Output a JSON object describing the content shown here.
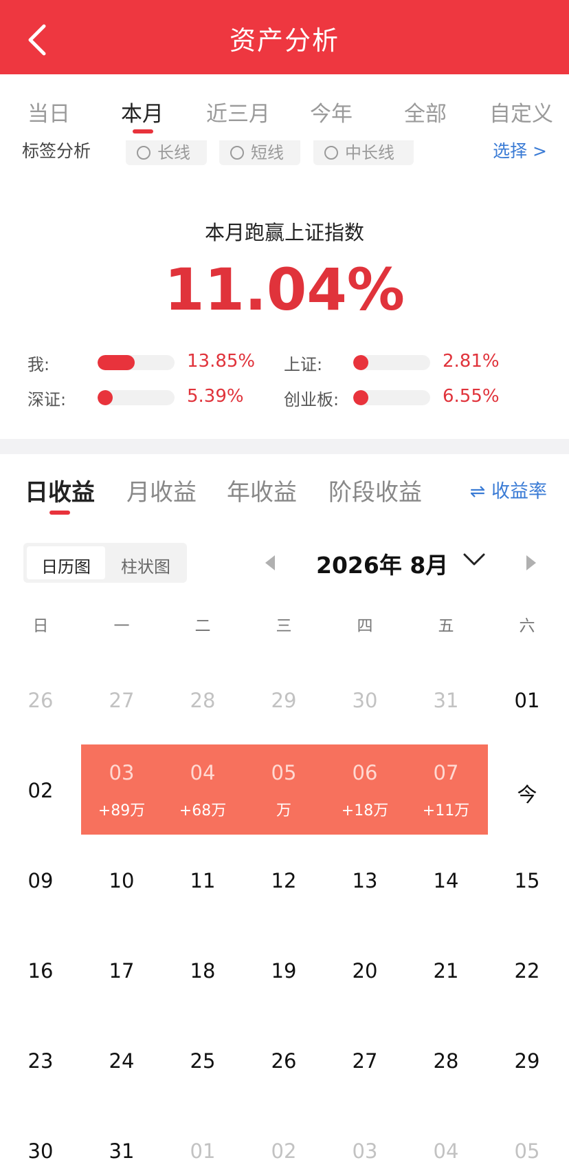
{
  "header": {
    "title": "资产分析"
  },
  "period_tabs": [
    "当日",
    "本月",
    "近三月",
    "今年",
    "全部",
    "自定义"
  ],
  "tags": {
    "title": "标签分析",
    "options": [
      "长线",
      "短线",
      "中长线"
    ],
    "select_label": "选择 >"
  },
  "summary": {
    "title": "本月跑赢上证指数",
    "value": "11.04%",
    "comparisons": [
      {
        "label": "我:",
        "value": "13.85%",
        "level": 0.48
      },
      {
        "label": "上证:",
        "value": "2.81%",
        "level": 0.08
      },
      {
        "label": "深证:",
        "value": "5.39%",
        "level": 0.15
      },
      {
        "label": "创业板:",
        "value": "6.55%",
        "level": 0.2
      }
    ]
  },
  "income_tabs": [
    "日收益",
    "月收益",
    "年收益",
    "阶段收益"
  ],
  "rate_link": "⇌ 收益率",
  "view_toggle": [
    "日历图",
    "柱状图"
  ],
  "calendar": {
    "month_label": "2026年 8月",
    "weekdays": [
      "日",
      "一",
      "二",
      "三",
      "四",
      "五",
      "六"
    ],
    "weeks": [
      [
        {
          "d": "26",
          "muted": true
        },
        {
          "d": "27",
          "muted": true
        },
        {
          "d": "28",
          "muted": true
        },
        {
          "d": "29",
          "muted": true
        },
        {
          "d": "30",
          "muted": true
        },
        {
          "d": "31",
          "muted": true
        },
        {
          "d": "01"
        }
      ],
      [
        {
          "d": "02"
        },
        {
          "d": "03",
          "gain": "+89万"
        },
        {
          "d": "04",
          "gain": "+68万"
        },
        {
          "d": "05",
          "gain": "万"
        },
        {
          "d": "06",
          "gain": "+18万"
        },
        {
          "d": "07",
          "gain": "+11万"
        },
        {
          "d": "今"
        }
      ],
      [
        {
          "d": "09"
        },
        {
          "d": "10"
        },
        {
          "d": "11"
        },
        {
          "d": "12"
        },
        {
          "d": "13"
        },
        {
          "d": "14"
        },
        {
          "d": "15"
        }
      ],
      [
        {
          "d": "16"
        },
        {
          "d": "17"
        },
        {
          "d": "18"
        },
        {
          "d": "19"
        },
        {
          "d": "20"
        },
        {
          "d": "21"
        },
        {
          "d": "22"
        }
      ],
      [
        {
          "d": "23"
        },
        {
          "d": "24"
        },
        {
          "d": "25"
        },
        {
          "d": "26"
        },
        {
          "d": "27"
        },
        {
          "d": "28"
        },
        {
          "d": "29"
        }
      ],
      [
        {
          "d": "30"
        },
        {
          "d": "31"
        },
        {
          "d": "01",
          "muted": true
        },
        {
          "d": "02",
          "muted": true
        },
        {
          "d": "03",
          "muted": true
        },
        {
          "d": "04",
          "muted": true
        },
        {
          "d": "05",
          "muted": true
        }
      ]
    ]
  },
  "colors": {
    "brand_red": "#ee3740",
    "gain_bg": "#f7715d",
    "link_blue": "#3a7bd5"
  }
}
